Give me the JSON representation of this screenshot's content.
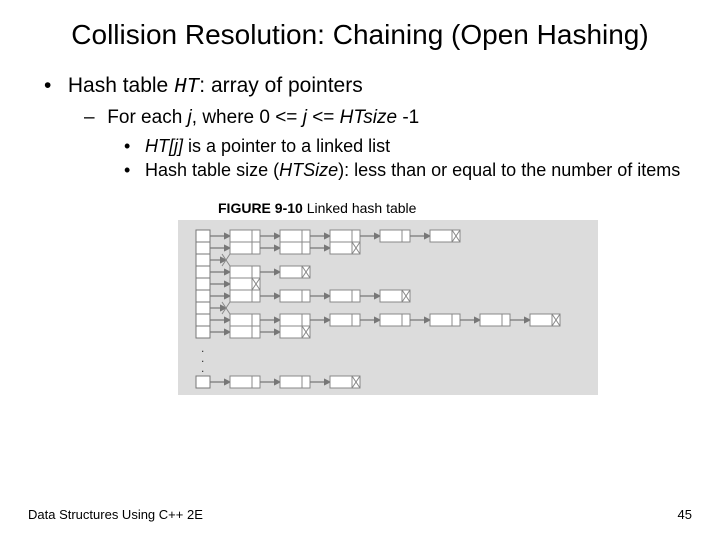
{
  "title": "Collision Resolution: Chaining (Open Hashing)",
  "bullets": {
    "l1_pre": "Hash table ",
    "l1_ht": "HT",
    "l1_post": ": array of pointers",
    "l2_pre": "For each ",
    "l2_j1": "j",
    "l2_mid1": ", where 0 <= ",
    "l2_j2": "j",
    "l2_mid2": " <= ",
    "l2_htsize": "HTsize",
    "l2_post": " -1",
    "l3a_pre": "HT",
    "l3a_j": "[j]",
    "l3a_post": " is a pointer to a linked list",
    "l3b_pre": "Hash table size (",
    "l3b_hts": "HTSize",
    "l3b_post": "): less than or equal to the number of items"
  },
  "figure": {
    "label_bold": "FIGURE 9-10",
    "label_rest": " Linked hash table"
  },
  "footer": {
    "left": "Data Structures Using C++ 2E",
    "right": "45"
  }
}
